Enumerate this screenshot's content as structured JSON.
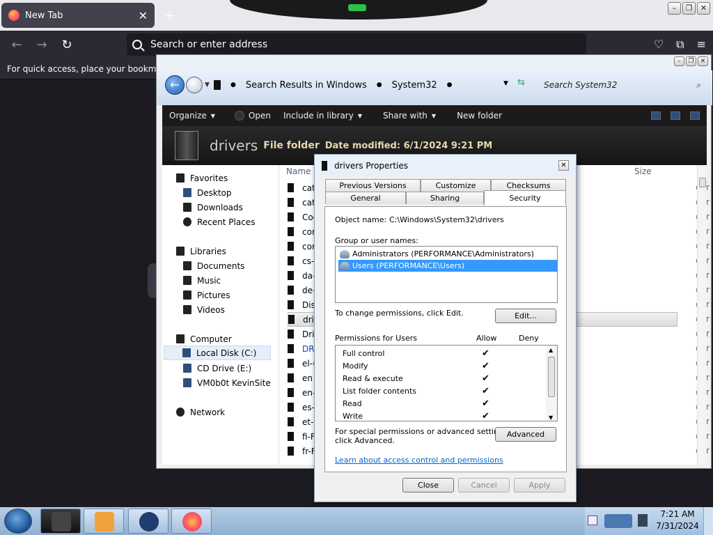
{
  "firefox": {
    "tab_title": "New Tab",
    "tab_close": "✕",
    "new_tab": "+",
    "url_placeholder": "Search or enter address",
    "bookmarks_text": "For quick access, place your bookmarks h"
  },
  "explorer": {
    "breadcrumb": [
      "Search Results in Windows",
      "System32"
    ],
    "search_placeholder": "Search System32",
    "toolbar": {
      "organize": "Organize",
      "open": "Open",
      "include": "Include in library",
      "share": "Share with",
      "new_folder": "New folder"
    },
    "details": {
      "name": "drivers",
      "type": "File folder",
      "modified": "Date modified: 6/1/2024 9:21 PM"
    },
    "nav": {
      "favorites": "Favorites",
      "desktop": "Desktop",
      "downloads": "Downloads",
      "recent": "Recent Places",
      "libraries": "Libraries",
      "documents": "Documents",
      "music": "Music",
      "pictures": "Pictures",
      "videos": "Videos",
      "computer": "Computer",
      "local_disk": "Local Disk (C:)",
      "cd_drive": "CD Drive (E:)",
      "vm_site": "VM0b0t KevinSite",
      "network": "Network"
    },
    "columns": {
      "name": "Name",
      "size": "Size"
    },
    "files": [
      "catr",
      "catr",
      "Coc",
      "con",
      "con",
      "cs-C",
      "da-",
      "de-",
      "Dis",
      "driv",
      "Driv",
      "DRV",
      "el-G",
      "en",
      "en-",
      "es-E",
      "et-E",
      "fi-F",
      "fr-F"
    ],
    "type_fragment": "der"
  },
  "dialog": {
    "title": "drivers Properties",
    "tabs": {
      "previous_versions": "Previous Versions",
      "customize": "Customize",
      "checksums": "Checksums",
      "general": "General",
      "sharing": "Sharing",
      "security": "Security"
    },
    "object_label": "Object name:",
    "object_value": "C:\\Windows\\System32\\drivers",
    "group_label": "Group or user names:",
    "groups": [
      "Administrators (PERFORMANCE\\Administrators)",
      "Users (PERFORMANCE\\Users)"
    ],
    "change_text": "To change permissions, click Edit.",
    "edit_btn": "Edit...",
    "perm_label": "Permissions for Users",
    "allow": "Allow",
    "deny": "Deny",
    "permissions": [
      {
        "name": "Full control",
        "allow": "✔"
      },
      {
        "name": "Modify",
        "allow": "✔"
      },
      {
        "name": "Read & execute",
        "allow": "✔"
      },
      {
        "name": "List folder contents",
        "allow": "✔"
      },
      {
        "name": "Read",
        "allow": "✔"
      },
      {
        "name": "Write",
        "allow": "✔"
      }
    ],
    "special_text_1": "For special permissions or advanced settings,",
    "special_text_2": "click Advanced.",
    "advanced_btn": "Advanced",
    "learn_link": "Learn about access control and permissions",
    "close_btn": "Close",
    "cancel_btn": "Cancel",
    "apply_btn": "Apply"
  },
  "taskbar": {
    "time": "7:21 AM",
    "date": "7/31/2024"
  }
}
